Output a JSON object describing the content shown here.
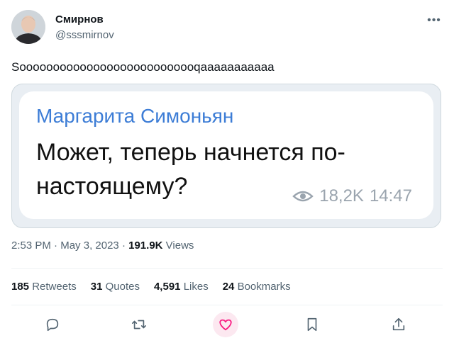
{
  "author": {
    "name": "Смирнов",
    "handle": "@sssmirnov"
  },
  "tweet": {
    "text": "Sooooooooooooooooooooooooooqaaaaaaaaaaa"
  },
  "media": {
    "sender": "Маргарита Симоньян",
    "message": "Может, теперь начнется по-настоящему?",
    "views": "18,2K",
    "time": "14:47"
  },
  "timestamp": {
    "time": "2:53 PM",
    "sep1": "·",
    "date": "May 3, 2023",
    "sep2": "·",
    "views_count": "191.9K",
    "views_label": "Views"
  },
  "stats": {
    "retweets": {
      "count": "185",
      "label": "Retweets"
    },
    "quotes": {
      "count": "31",
      "label": "Quotes"
    },
    "likes": {
      "count": "4,591",
      "label": "Likes"
    },
    "bookmarks": {
      "count": "24",
      "label": "Bookmarks"
    }
  },
  "icons": {
    "more": "more-icon",
    "reply": "reply-icon",
    "retweet": "retweet-icon",
    "like": "heart-icon",
    "bookmark": "bookmark-icon",
    "share": "share-icon",
    "views": "eye-icon"
  },
  "colors": {
    "text": "#0f1419",
    "secondary": "#536471",
    "sender_blue": "#3d7dd6",
    "like_pink": "#f91880",
    "like_bg": "#fce8f0",
    "meta_gray": "#9aa4ae"
  }
}
